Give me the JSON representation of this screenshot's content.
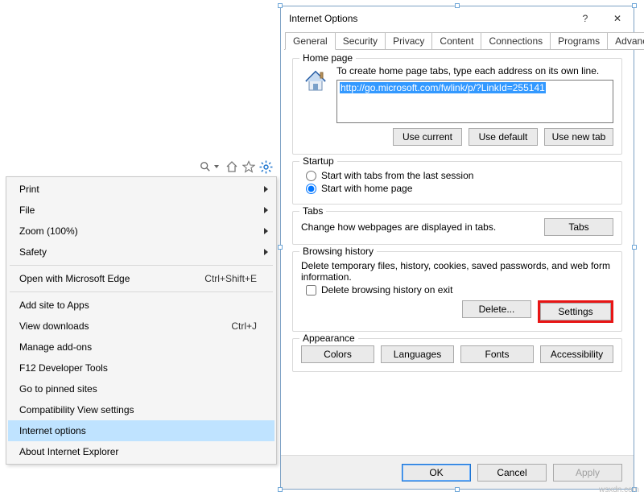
{
  "toolbar": {
    "icons": {
      "search": "search-icon",
      "home": "home-icon",
      "star": "star-icon",
      "gear": "gear-icon"
    }
  },
  "context_menu": {
    "items": [
      {
        "label": "Print",
        "has_sub": true
      },
      {
        "label": "File",
        "has_sub": true
      },
      {
        "label": "Zoom (100%)",
        "has_sub": true
      },
      {
        "label": "Safety",
        "has_sub": true
      },
      {
        "sep": true
      },
      {
        "label": "Open with Microsoft Edge",
        "hotkey": "Ctrl+Shift+E"
      },
      {
        "sep": true
      },
      {
        "label": "Add site to Apps"
      },
      {
        "label": "View downloads",
        "hotkey": "Ctrl+J"
      },
      {
        "label": "Manage add-ons"
      },
      {
        "label": "F12 Developer Tools"
      },
      {
        "label": "Go to pinned sites"
      },
      {
        "label": "Compatibility View settings"
      },
      {
        "label": "Internet options",
        "selected": true
      },
      {
        "label": "About Internet Explorer"
      }
    ]
  },
  "dialog": {
    "title": "Internet Options",
    "help": "?",
    "close": "✕",
    "tabs": [
      "General",
      "Security",
      "Privacy",
      "Content",
      "Connections",
      "Programs",
      "Advanced"
    ],
    "active_tab": "General",
    "homepage": {
      "heading": "Home page",
      "instruction": "To create home page tabs, type each address on its own line.",
      "url": "http://go.microsoft.com/fwlink/p/?LinkId=255141",
      "use_current": "Use current",
      "use_default": "Use default",
      "use_new_tab": "Use new tab"
    },
    "startup": {
      "heading": "Startup",
      "option_last": "Start with tabs from the last session",
      "option_home": "Start with home page",
      "selected": "home"
    },
    "tabs_section": {
      "heading": "Tabs",
      "text": "Change how webpages are displayed in tabs.",
      "button": "Tabs"
    },
    "history": {
      "heading": "Browsing history",
      "text": "Delete temporary files, history, cookies, saved passwords, and web form information.",
      "check_label": "Delete browsing history on exit",
      "delete_btn": "Delete...",
      "settings_btn": "Settings"
    },
    "appearance": {
      "heading": "Appearance",
      "colors": "Colors",
      "languages": "Languages",
      "fonts": "Fonts",
      "accessibility": "Accessibility"
    },
    "footer": {
      "ok": "OK",
      "cancel": "Cancel",
      "apply": "Apply"
    }
  },
  "watermark": "wsxdn.com"
}
